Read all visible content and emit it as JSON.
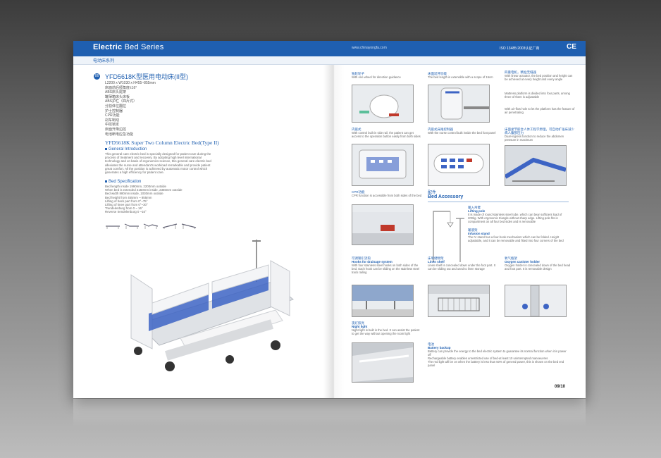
{
  "header": {
    "series_bold": "Electric",
    "series_rest": " Bed Series",
    "url": "www.chinayongfa.com",
    "iso": "ISO 13485:2003认证厂商",
    "ce": "CE",
    "sub_cn": "电动床系列"
  },
  "product": {
    "number": "06",
    "model_cn": "YFD5618K型医用电动床(II型)",
    "specs_cn": [
      "L2200 x W1030 x H455~855mm",
      "床面前后倾角度±16°",
      "ABS床头尾架",
      "罐薄箱床头床板",
      "ABS护栏（四片式）",
      "分割体位翻拉",
      "护士控制器",
      "CPR功能",
      "刹车制动",
      "中控锁定",
      "床面升降边控",
      "电池断电应急功能"
    ],
    "model_en": "YFD5618K Super Two Column Electric Bed(Type II)",
    "general_title": "General Introduction",
    "general_text": "This general care electric bed is specially designed for patient care during the process of treatment and recovery. By adopting high level international technology and on basis of ergonomics science, this general care electric bed alleviates the nurse and attendant's workload remarkable and provide patient great comfort. All the position is achieved by automatic motor control which generates a high efficiency for patient care.",
    "spec_title": "Bed Specification",
    "spec_lines": [
      "Bed length inside 1990mm, 2200mm outside",
      "When bed is extended 2150mm inside, 2360mm outside",
      "Bed width 880mm inside, 1030mm outside",
      "Bed height from 455mm ~ 855mm",
      "Lifting of back part from 0°~75°",
      "Lifting of knee part from 0°~30°",
      "Trendelenburg from 0 ~ 16°",
      "Reverse trendelenburg 0 ~16°"
    ]
  },
  "features": [
    {
      "cn": "独轮轮子",
      "en": "",
      "desc": "With one wheel for direction guidance"
    },
    {
      "cn": "床面延伸功能",
      "en": "",
      "desc": "The bed length is extensible with a scope of 15cm"
    },
    {
      "cn": "四重电机，精准无缝器",
      "en": "",
      "desc": "With linear actuator, the bed position and height can be achieved at every height and every angle"
    },
    {
      "cn": "",
      "en": "",
      "desc": "Mattress platform is divided into four parts, among three of them is adjustable"
    },
    {
      "cn": "",
      "en": "",
      "desc": "With air-flow hole to let the platform has the feature of air penetrating"
    },
    {
      "cn": "内嵌式",
      "en": "",
      "desc": "With control built in side rail, the patient can get access to the operation button easily from both sides"
    },
    {
      "cn": "内嵌式床尾控制器",
      "en": "",
      "desc": "With the nurse control built inside the bed foot panel"
    },
    {
      "cn": "床面坐节胶合人体工程学原理，可自动扩张床减少病人腹部压力",
      "en": "",
      "desc": "Dual-regress function to reduce the abdomen pressure in maximum"
    },
    {
      "cn": "CPR功能",
      "en": "",
      "desc": "CPR function is accessible from both sides of the bed"
    },
    {
      "cn": "可调钢引流钩",
      "en": "Hooks for drainage system",
      "desc": "With four stainless steel hooks on both sides of the bed. Each hook can be sliding on the stainless steel track railing"
    },
    {
      "cn": "床单储物架",
      "en": "Linen shelf",
      "desc": "Linen shelf is concealed down under the foot part. It can be sliding out and used to linen storage"
    },
    {
      "cn": "氧气瓶架",
      "en": "Oxygen canister holder",
      "desc": "Oxygen holder is concealed down of the bed head and foot part. It is removable design"
    },
    {
      "cn": "夜灯照亮",
      "en": "Night light",
      "desc": "Night light is built in the bed. It can assist the patient to get the way without opening the room light"
    }
  ],
  "accessory": {
    "cn": "配件",
    "en": "Bed Accessory",
    "items": [
      {
        "cn": "输入吊臂",
        "en": "Lifting pole",
        "desc": "It is made of round stainless steel tube, which can bear sufficient load of 200kg. With ergonomic triangle without sharp edge. Lifting pole fits in compartment on all four bed sides and is removable"
      },
      {
        "cn": "输液架",
        "en": "Infusion stand",
        "desc": "The IV stand has a four-hook mechanism which can be folded. Height adjustable, and it can be removable and fitted into four corners of the bed"
      }
    ]
  },
  "battery": {
    "cn": "电池",
    "en": "Battery backup",
    "desc1": "Battery can provide the energy to the bed electric system to guarantee its normal function when it is power off",
    "desc2": "Rechargeable battery enables unrestricted use of bed-at least 10 uninterrupted manoeuvres",
    "desc3": "The red light will be on when the battery is less than 50% of general power, this is shown on the bed end panel"
  },
  "page_number": "09/10",
  "colors": {
    "accent": "#1f5fb0",
    "band": "#1f5fb0"
  }
}
